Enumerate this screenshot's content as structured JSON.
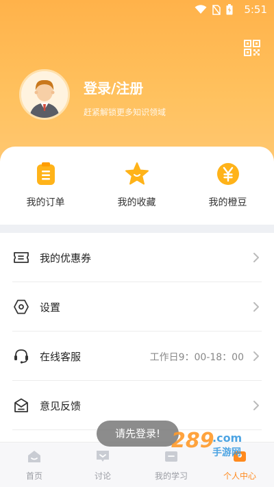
{
  "status_bar": {
    "time": "5:51"
  },
  "profile": {
    "login_label": "登录/注册",
    "subtitle": "赶紧解锁更多知识领域"
  },
  "quick_actions": [
    {
      "label": "我的订单",
      "icon": "clipboard-icon"
    },
    {
      "label": "我的收藏",
      "icon": "star-icon"
    },
    {
      "label": "我的橙豆",
      "icon": "yen-coin-icon"
    }
  ],
  "menu": [
    {
      "label": "我的优惠券",
      "value": "",
      "icon": "coupon-icon"
    },
    {
      "label": "设置",
      "value": "",
      "icon": "settings-hexagon-icon"
    },
    {
      "label": "在线客服",
      "value": "工作日9：00-18：00",
      "icon": "headset-icon"
    },
    {
      "label": "意见反馈",
      "value": "",
      "icon": "feedback-envelope-icon"
    }
  ],
  "tabs": [
    {
      "label": "首页",
      "icon": "home-icon",
      "active": false
    },
    {
      "label": "讨论",
      "icon": "chat-icon",
      "active": false
    },
    {
      "label": "我的学习",
      "icon": "study-icon",
      "active": false
    },
    {
      "label": "个人中心",
      "icon": "profile-icon",
      "active": true
    }
  ],
  "toast": {
    "text": "请先登录!"
  },
  "watermark": {
    "text": "289.com 手游网"
  },
  "colors": {
    "accent": "#ff8a1e",
    "hero_top": "#ffb24a",
    "hero_bottom": "#ffc873",
    "icon_yellow": "#ffb319"
  }
}
